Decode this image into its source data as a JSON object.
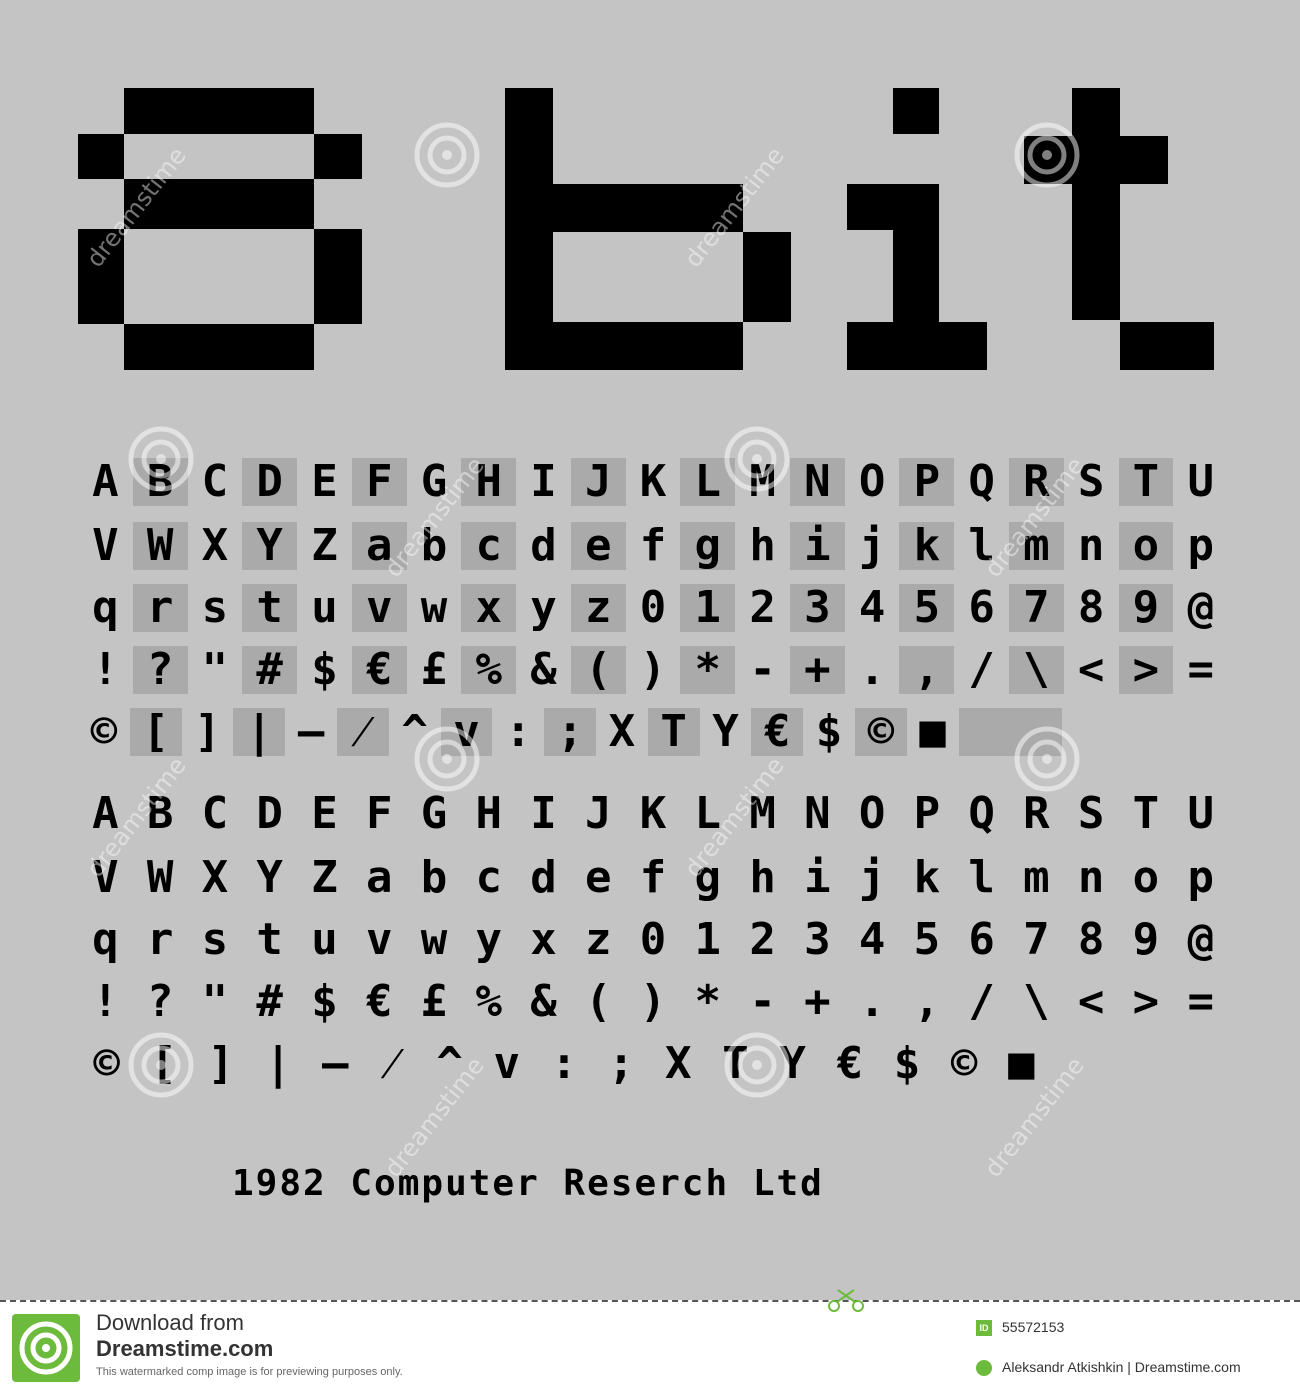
{
  "title": "8bit",
  "block1": {
    "rows": [
      [
        "A",
        "B",
        "C",
        "D",
        "E",
        "F",
        "G",
        "H",
        "I",
        "J",
        "K",
        "L",
        "M",
        "N",
        "O",
        "P",
        "Q",
        "R",
        "S",
        "T",
        "U"
      ],
      [
        "V",
        "W",
        "X",
        "Y",
        "Z",
        "a",
        "b",
        "c",
        "d",
        "e",
        "f",
        "g",
        "h",
        "i",
        "j",
        "k",
        "l",
        "m",
        "n",
        "o",
        "p"
      ],
      [
        "q",
        "r",
        "s",
        "t",
        "u",
        "v",
        "w",
        "x",
        "y",
        "z",
        "0",
        "1",
        "2",
        "3",
        "4",
        "5",
        "6",
        "7",
        "8",
        "9",
        "@"
      ],
      [
        "!",
        "?",
        "\"",
        "#",
        "$",
        "€",
        "£",
        "%",
        "&",
        "(",
        ")",
        "*",
        "-",
        "+",
        ".",
        ",",
        "/",
        "\\",
        "<",
        ">",
        "="
      ],
      [
        "©",
        "[",
        "]",
        "|",
        "—",
        "⁄",
        "^",
        "v",
        ":",
        ";",
        "X",
        "T",
        "Y",
        "€",
        "$",
        "©",
        "■",
        "",
        ""
      ]
    ]
  },
  "block2": {
    "rows": [
      [
        "A",
        "B",
        "C",
        "D",
        "E",
        "F",
        "G",
        "H",
        "I",
        "J",
        "K",
        "L",
        "M",
        "N",
        "O",
        "P",
        "Q",
        "R",
        "S",
        "T",
        "U"
      ],
      [
        "V",
        "W",
        "X",
        "Y",
        "Z",
        "a",
        "b",
        "c",
        "d",
        "e",
        "f",
        "g",
        "h",
        "i",
        "j",
        "k",
        "l",
        "m",
        "n",
        "o",
        "p"
      ],
      [
        "q",
        "r",
        "s",
        "t",
        "u",
        "v",
        "w",
        "y",
        "x",
        "z",
        "0",
        "1",
        "2",
        "3",
        "4",
        "5",
        "6",
        "7",
        "8",
        "9",
        "@"
      ],
      [
        "!",
        "?",
        "\"",
        "#",
        "$",
        "€",
        "£",
        "%",
        "&",
        "(",
        ")",
        "*",
        "-",
        "+",
        ".",
        ",",
        "/",
        "\\",
        "<",
        ">",
        "="
      ],
      [
        "©",
        "[",
        "]",
        "|",
        "—",
        "⁄",
        "^",
        "v",
        ":",
        ";",
        "X",
        "T",
        "Y",
        "€",
        "$",
        "©",
        "■"
      ]
    ]
  },
  "credit": "1982 Computer Reserch Ltd",
  "watermark": "dreamstime",
  "footer": {
    "download": "Download from",
    "brand": "Dreamstime.com",
    "note": "This watermarked comp image is for previewing purposes only.",
    "id_badge": "ID",
    "id": "55572153",
    "author": "Aleksandr Atkishkin | Dreamstime.com"
  },
  "colors": {
    "background": "#c4c4c4",
    "shade": "#aaaaaa",
    "ink": "#000000",
    "brand": "#6dbb3c"
  }
}
